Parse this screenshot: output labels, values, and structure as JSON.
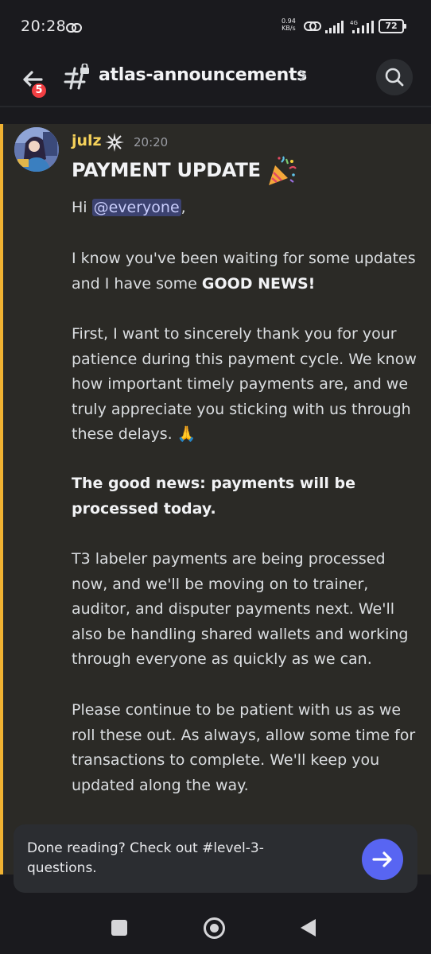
{
  "status_bar": {
    "time": "20:28",
    "net_speed_value": "0.94",
    "net_speed_unit": "KB/s",
    "battery": "72"
  },
  "header": {
    "channel_name": "atlas-announcements",
    "notification_count": "5"
  },
  "message": {
    "author": "julz",
    "timestamp": "20:20",
    "title": "PAYMENT UPDATE",
    "greeting_prefix": "Hi ",
    "mention": "@everyone",
    "greeting_suffix": ",",
    "p1_text": "I know you've been waiting for some updates and I have some ",
    "p1_bold": "GOOD NEWS!",
    "p2_text": "First, I want to sincerely thank you for your patience during this payment cycle. We know how important timely payments are, and we truly appreciate you sticking with us through these delays. ",
    "p2_emoji": "🙏",
    "p3_bold": "The good news: payments will be processed today.",
    "p4_text": "T3 labeler payments are being processed now, and we'll be moving on to trainer, auditor, and disputer payments next. We'll also be handling shared wallets and working through everyone as quickly as we can.",
    "p5_text": "Please continue to be patient with us as we roll these out. As always, allow some time for transactions to complete. We'll keep you updated along the way."
  },
  "prompt": {
    "text": "Done reading? Check out #level-3-questions."
  },
  "colors": {
    "accent": "#5865f2",
    "highlight_bar": "#f0b232",
    "author": "#f6d25a",
    "badge": "#f23f43"
  },
  "icons": [
    "link-icon",
    "signal-icon",
    "wifi-icon",
    "battery-icon",
    "back-arrow-icon",
    "locked-channel-icon",
    "chevron-right-icon",
    "search-icon",
    "role-icon",
    "party-popper-icon",
    "arrow-right-icon",
    "recent-apps-icon",
    "home-icon",
    "nav-back-icon"
  ]
}
